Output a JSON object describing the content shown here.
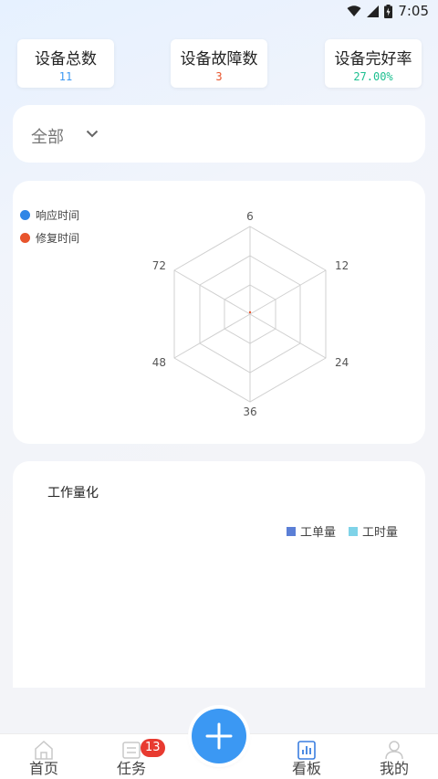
{
  "status_bar": {
    "time": "7:05"
  },
  "stats": [
    {
      "label": "设备总数",
      "value": "11",
      "color": "#3b98f3"
    },
    {
      "label": "设备故障数",
      "value": "3",
      "color": "#e8542c"
    },
    {
      "label": "设备完好率",
      "value": "27.00%",
      "color": "#1bbf8f"
    }
  ],
  "filter": {
    "selected": "全部"
  },
  "radar": {
    "legend": [
      {
        "label": "响应时间",
        "color": "#2f86e6"
      },
      {
        "label": "修复时间",
        "color": "#e8542c"
      }
    ],
    "axis_labels": [
      "6",
      "12",
      "24",
      "36",
      "48",
      "72"
    ]
  },
  "work": {
    "title": "工作量化",
    "legend": [
      {
        "label": "工单量",
        "color": "#5b7fd6"
      },
      {
        "label": "工时量",
        "color": "#7fd3e8"
      }
    ]
  },
  "tabbar": {
    "home": "首页",
    "tasks": "任务",
    "tasks_badge": "13",
    "board": "看板",
    "mine": "我的"
  }
}
